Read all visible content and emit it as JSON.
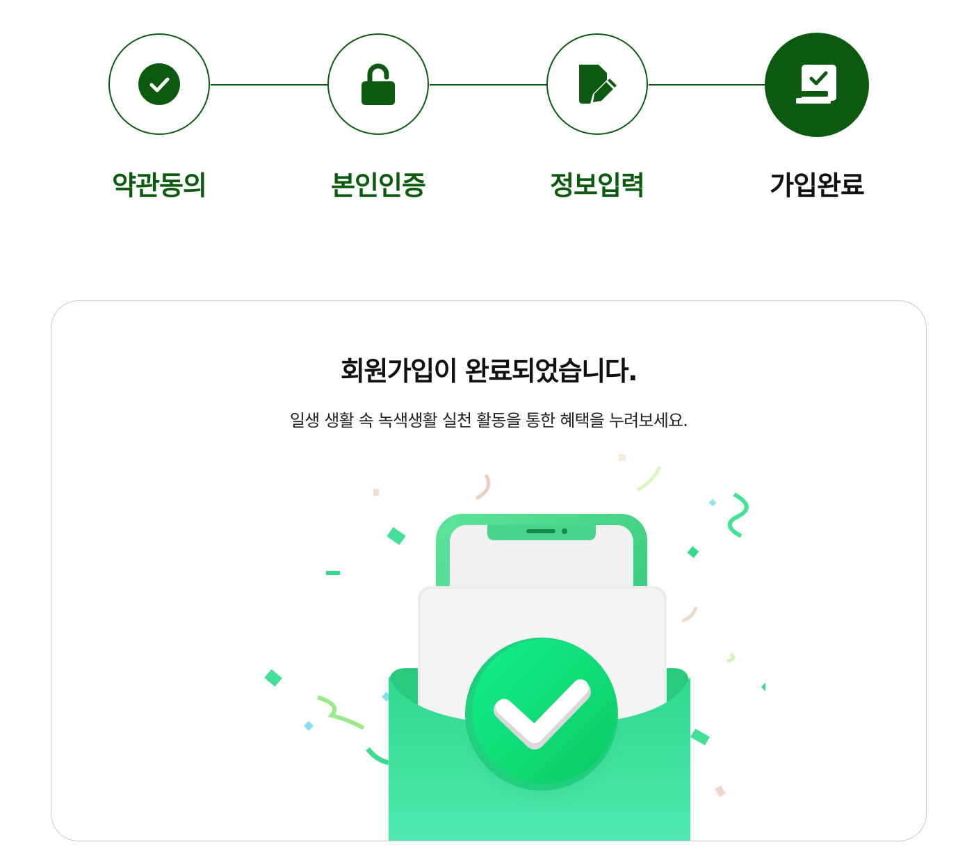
{
  "stepper": {
    "steps": [
      {
        "label": "약관동의",
        "icon": "check-circle-icon",
        "state": "done"
      },
      {
        "label": "본인인증",
        "icon": "unlock-icon",
        "state": "done"
      },
      {
        "label": "정보입력",
        "icon": "edit-document-icon",
        "state": "done"
      },
      {
        "label": "가입완료",
        "icon": "signed-document-icon",
        "state": "active"
      }
    ],
    "colors": {
      "primary": "#0b5a10",
      "active_label": "#111111"
    }
  },
  "card": {
    "title": "회원가입이 완료되었습니다.",
    "subtitle": "일생 생활 속 녹색생활 실천 활동을 통한 혜택을 누려보세요.",
    "illustration": "signup-complete-phone-envelope-illustration",
    "colors": {
      "accent": "#2fdc8c",
      "border": "#c8c8c8"
    }
  }
}
